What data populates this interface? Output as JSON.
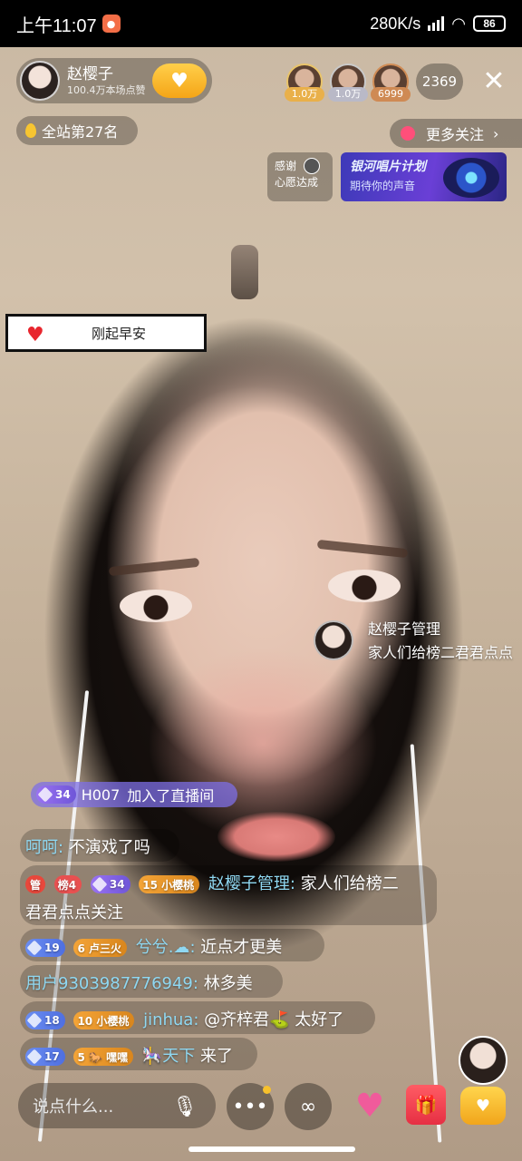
{
  "status_bar": {
    "time": "上午11:07",
    "net_speed": "280K/s",
    "battery": "86"
  },
  "anchor": {
    "name": "赵樱子",
    "likes": "100.4万本场点赞"
  },
  "top_viewers": [
    {
      "amount": "1.0万"
    },
    {
      "amount": "1.0万"
    },
    {
      "amount": "6999"
    }
  ],
  "viewer_count": "2369",
  "rank_badge": "全站第27名",
  "more_follow": "更多关注",
  "thanks_card": {
    "line1": "感谢",
    "line2": "心愿达成"
  },
  "banner": {
    "title": "银河唱片计划",
    "subtitle": "期待你的声音"
  },
  "notice": {
    "text": "刚起早安"
  },
  "floating_message": {
    "name": "赵樱子管理",
    "text": "家人们给榜二君君点点"
  },
  "join_notice": {
    "level": "34",
    "user": "H007",
    "action": "加入了直播间"
  },
  "chat": [
    {
      "user": "呵呵",
      "text": "不演戏了吗"
    },
    {
      "badges": [
        "管",
        "榜4",
        "34",
        "15 小樱桃"
      ],
      "user": "赵樱子管理",
      "text": "家人们给榜二",
      "text2": "君君点点关注"
    },
    {
      "badges": [
        "19",
        "6 卢三火"
      ],
      "user": "兮兮.☁",
      "text": "近点才更美"
    },
    {
      "user": "用户9303987776949",
      "text": "林多美"
    },
    {
      "badges": [
        "18",
        "10 小樱桃"
      ],
      "user": "jinhua",
      "text": "@齐梓君⛳ 太好了"
    },
    {
      "badges": [
        "17",
        "5 🐎 嘿嘿"
      ],
      "user": "🎠天下",
      "text": "来了"
    }
  ],
  "bottom_bar": {
    "input_placeholder": "说点什么..."
  },
  "colors": {
    "username": "#8fd8f2",
    "follow_gold": "#f5a517",
    "join_purple": "#7d6fe6"
  },
  "icons": [
    "wifi-icon",
    "signal-icon",
    "battery-icon",
    "close-icon",
    "mic-icon",
    "more-icon",
    "link-icon",
    "heart-icon",
    "gift-icon",
    "heart-plus-icon",
    "chevron-right-icon"
  ]
}
